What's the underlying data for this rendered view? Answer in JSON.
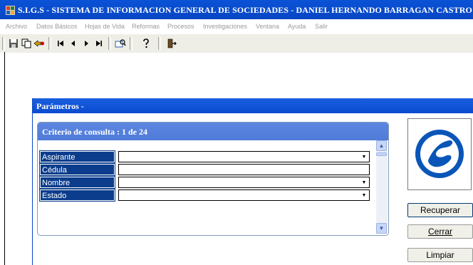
{
  "window": {
    "title": "S.I.G.S   - SISTEMA DE INFORMACION GENERAL DE SOCIEDADES - DANIEL HERNANDO BARRAGAN CASTRO"
  },
  "menu": {
    "items": [
      {
        "label": "Archivo"
      },
      {
        "label": "Datos Básicos"
      },
      {
        "label": "Hojas de Vida"
      },
      {
        "label": "Reformas"
      },
      {
        "label": "Procesos"
      },
      {
        "label": "Investigaciones"
      },
      {
        "label": "Ventana"
      },
      {
        "label": "Ayuda"
      },
      {
        "label": "Salir"
      }
    ]
  },
  "toolbar": {
    "icons": [
      "save-icon",
      "copy-icon",
      "undo-icon",
      "first-record-icon",
      "previous-record-icon",
      "next-record-icon",
      "last-record-icon",
      "query-icon",
      "help-icon",
      "exit-icon"
    ]
  },
  "parameters": {
    "title": "Parámetros -",
    "criteria": "Criterio de consulta : 1  de  24",
    "fields": [
      {
        "label": "Aspirante",
        "value": "",
        "type": "dropdown"
      },
      {
        "label": "Cédula",
        "value": "",
        "type": "text"
      },
      {
        "label": "Nombre",
        "value": "",
        "type": "dropdown"
      },
      {
        "label": "Estado",
        "value": "",
        "type": "dropdown"
      }
    ]
  },
  "buttons": {
    "recuperar": "Recuperar",
    "cerrar": "Cerrar",
    "limpiar": "Limpiar"
  },
  "colors": {
    "titlebar": "#0a52d6",
    "label_bg": "#0b3d8c",
    "criteria_header": "#5d86e0",
    "logo_blue": "#0a56b8"
  }
}
